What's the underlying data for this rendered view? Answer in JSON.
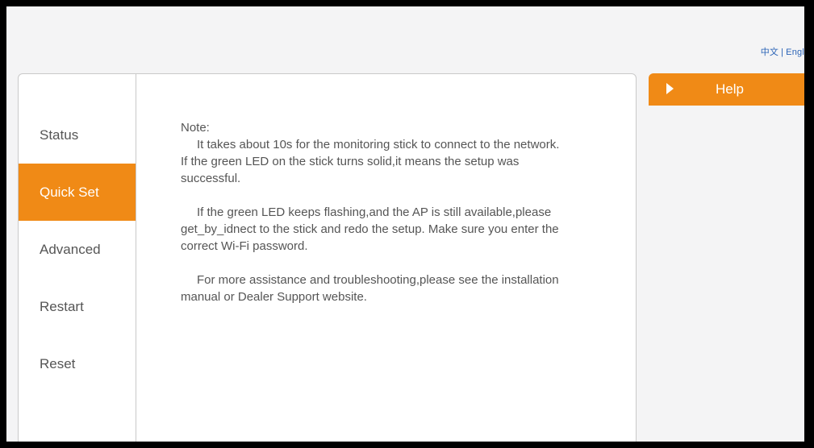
{
  "language_switch": {
    "chinese": "中文",
    "separator": "|",
    "english": "Engl"
  },
  "nav": {
    "items": [
      {
        "label": "Status",
        "active": false
      },
      {
        "label": "Quick Set",
        "active": true
      },
      {
        "label": "Advanced",
        "active": false
      },
      {
        "label": "Restart",
        "active": false
      },
      {
        "label": "Reset",
        "active": false
      }
    ]
  },
  "content": {
    "note_heading": "Note:",
    "paragraph1": "It takes about 10s for the monitoring stick to connect to the network. If the green LED on the stick turns solid,it means the setup was successful.",
    "paragraph2": "If the green LED keeps flashing,and the AP is still available,please get_by_idnect to the stick and redo the setup. Make sure you enter the correct Wi-Fi password.",
    "paragraph3": "For more assistance and troubleshooting,please see the installation manual or Dealer Support website."
  },
  "help": {
    "label": "Help",
    "icon": "caret-right-icon"
  },
  "colors": {
    "accent": "#f08a16",
    "text": "#555555",
    "link": "#2a63b6",
    "background": "#f4f4f5"
  }
}
